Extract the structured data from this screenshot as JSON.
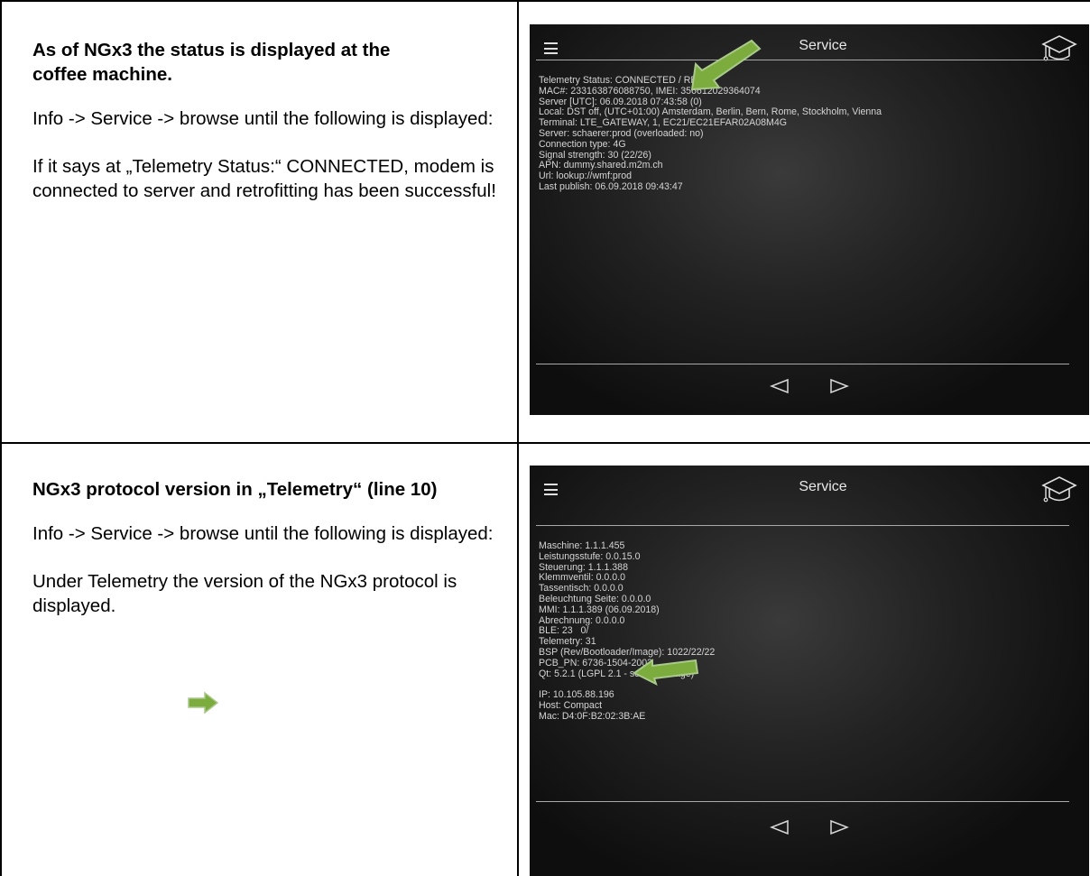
{
  "rows": [
    {
      "title": "As of NGx3 the status is displayed at the coffee machine.",
      "paragraphs": [
        "Info -> Service -> browse until the following is displayed:",
        "If it says at „Telemetry Status:“ CONNECTED, modem is connected to server and retrofitting has been successful!"
      ],
      "screen": {
        "header_title": "Service",
        "icons": {
          "menu": "hamburger-menu-icon",
          "help": "graduation-cap-icon",
          "prev": "triangle-left-icon",
          "next": "triangle-right-icon"
        },
        "lines": [
          "Telemetry Status: CONNECTED / READY",
          "MAC#: 233163876088750, IMEI: 356612029364074",
          "Server [UTC]: 06.09.2018 07:43:58 (0)",
          "Local: DST off, (UTC+01:00) Amsterdam, Berlin, Bern, Rome, Stockholm, Vienna",
          "Terminal: LTE_GATEWAY, 1, EC21/EC21EFAR02A08M4G",
          "Server: schaerer:prod (overloaded: no)",
          "Connection type: 4G",
          "Signal strength: 30 (22/26)",
          "APN: dummy.shared.m2m.ch",
          "Url: lookup://wmf:prod",
          "Last publish: 06.09.2018 09:43:47"
        ]
      }
    },
    {
      "title": "NGx3 protocol version in „Telemetry“ (line 10)",
      "paragraphs": [
        "Info -> Service -> browse until the following is displayed:",
        "Under Telemetry the version of the NGx3 protocol is displayed."
      ],
      "screen": {
        "header_title": "Service",
        "icons": {
          "menu": "hamburger-menu-icon",
          "help": "graduation-cap-icon",
          "prev": "triangle-left-icon",
          "next": "triangle-right-icon"
        },
        "lines": [
          "Maschine: 1.1.1.455",
          "Leistungsstufe: 0.0.15.0",
          "Steuerung: 1.1.1.388",
          "Klemmventil: 0.0.0.0",
          "Tassentisch: 0.0.0.0",
          "Beleuchtung Seite: 0.0.0.0",
          "MMI: 1.1.1.389 (06.09.2018)",
          "Abrechnung: 0.0.0.0",
          "BLE: 23   0/",
          "Telemetry: 31",
          "BSP (Rev/Bootloader/Image): 1022/22/22",
          "PCB_PN: 6736-1504-2003",
          "Qt: 5.2.1 (LGPL 2.1 - see next Page)",
          "",
          "IP: 10.105.88.196",
          "Host: Compact",
          "Mac: D4:0F:B2:02:3B:AE"
        ]
      }
    }
  ],
  "colors": {
    "arrow_green": "#7dac3e",
    "arrow_outline": "#a9c98a",
    "border": "#000000"
  }
}
